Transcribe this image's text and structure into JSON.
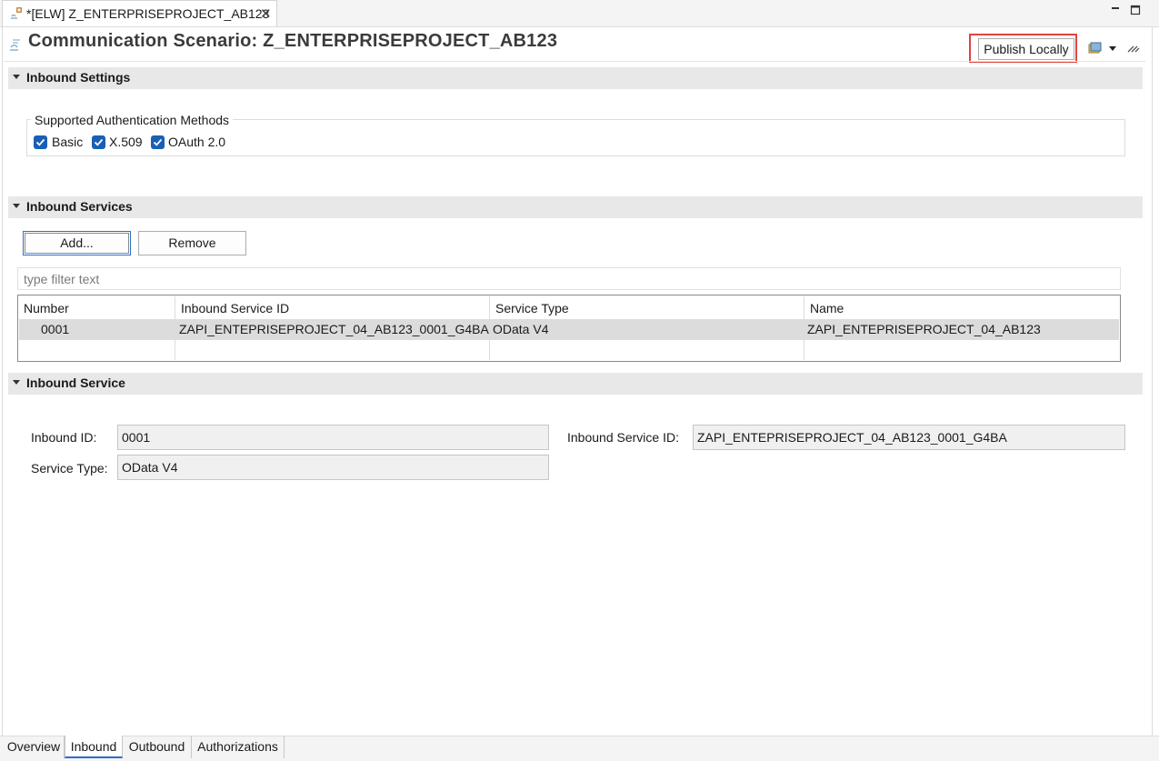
{
  "editor_tab": {
    "title": "*[ELW] Z_ENTERPRISEPROJECT_AB123",
    "icon": "communication-scenario-icon",
    "close_icon": "close-icon"
  },
  "window_controls": {
    "minimize_icon": "minimize-icon",
    "maximize_icon": "maximize-icon"
  },
  "header": {
    "title": "Communication Scenario: Z_ENTERPRISEPROJECT_AB123",
    "publish_button": "Publish Locally",
    "highlight_color": "#e0443e"
  },
  "inbound_settings": {
    "section_title": "Inbound Settings",
    "group_label": "Supported Authentication Methods",
    "auth_methods": [
      {
        "label": "Basic",
        "checked": true
      },
      {
        "label": "X.509",
        "checked": true
      },
      {
        "label": "OAuth 2.0",
        "checked": true
      }
    ]
  },
  "inbound_services": {
    "section_title": "Inbound Services",
    "add_button": "Add...",
    "remove_button": "Remove",
    "filter_placeholder": "type filter text",
    "columns": [
      "Number",
      "Inbound Service ID",
      "Service Type",
      "Name"
    ],
    "rows": [
      {
        "number": "0001",
        "service_id": "ZAPI_ENTEPRISEPROJECT_04_AB123_0001_G4BA",
        "service_type": "OData V4",
        "name": "ZAPI_ENTEPRISEPROJECT_04_AB123",
        "selected": true
      }
    ]
  },
  "inbound_service": {
    "section_title": "Inbound Service",
    "inbound_id_label": "Inbound ID:",
    "inbound_id_value": "0001",
    "service_type_label": "Service Type:",
    "service_type_value": "OData V4",
    "service_id_label": "Inbound Service ID:",
    "service_id_value": "ZAPI_ENTEPRISEPROJECT_04_AB123_0001_G4BA"
  },
  "page_tabs": [
    {
      "label": "Overview",
      "active": false
    },
    {
      "label": "Inbound",
      "active": true
    },
    {
      "label": "Outbound",
      "active": false
    },
    {
      "label": "Authorizations",
      "active": false
    }
  ],
  "colors": {
    "checkbox": "#1a5fb4",
    "section_bg": "#e8e8e8",
    "selected_row": "#dcdcdc",
    "active_tab_underline": "#2a6fcb"
  }
}
